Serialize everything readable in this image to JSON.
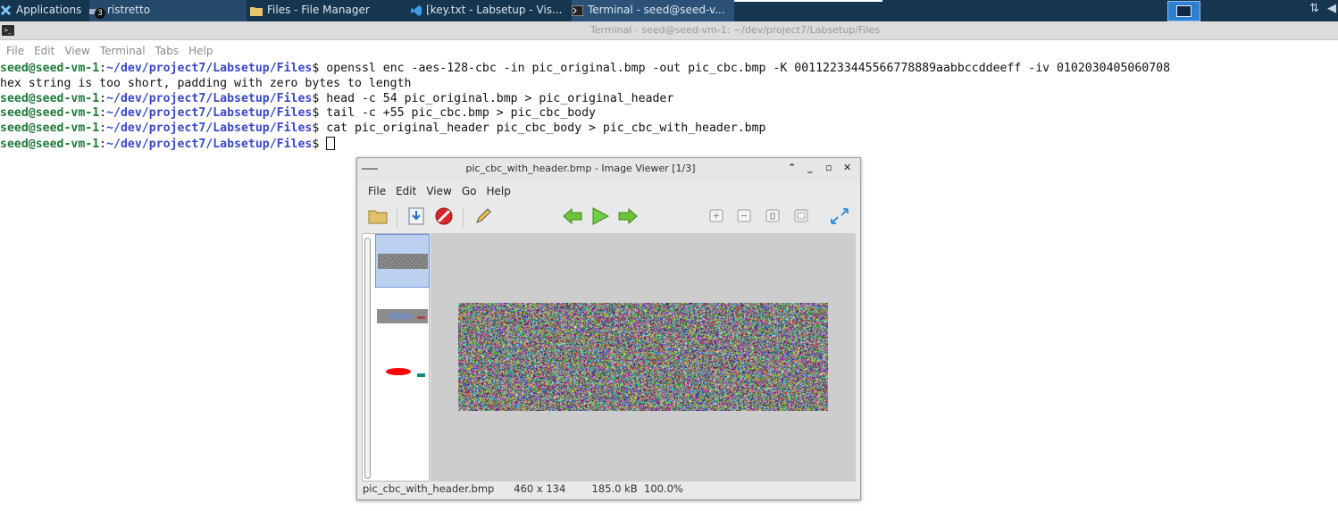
{
  "panel": {
    "applications": "Applications",
    "ristretto_badge": "3",
    "ristretto": "ristretto",
    "file_manager": "Files - File Manager",
    "vscode": "[key.txt - Labsetup - Vis...",
    "terminal": "Terminal - seed@seed-v..."
  },
  "terminal": {
    "title": "Terminal - seed@seed-vm-1: ~/dev/project7/Labsetup/Files",
    "menu": [
      "File",
      "Edit",
      "View",
      "Terminal",
      "Tabs",
      "Help"
    ],
    "prompt_user": "seed@seed-vm-1",
    "prompt_sep": ":",
    "prompt_path": "~/dev/project7/Labsetup/Files",
    "prompt_end": "$ ",
    "lines": [
      {
        "type": "cmd",
        "text": "openssl enc -aes-128-cbc -in pic_original.bmp -out pic_cbc.bmp -K 00112233445566778889aabbccddeeff -iv 0102030405060708"
      },
      {
        "type": "out",
        "text": "hex string is too short, padding with zero bytes to length"
      },
      {
        "type": "cmd",
        "text": "head -c 54 pic_original.bmp > pic_original_header"
      },
      {
        "type": "cmd",
        "text": "tail -c +55 pic_cbc.bmp > pic_cbc_body"
      },
      {
        "type": "cmd",
        "text": "cat pic_original_header pic_cbc_body > pic_cbc_with_header.bmp"
      },
      {
        "type": "cmd",
        "text": ""
      }
    ]
  },
  "viewer": {
    "title": "pic_cbc_with_header.bmp - Image Viewer [1/3]",
    "menu": [
      "File",
      "Edit",
      "View",
      "Go",
      "Help"
    ],
    "status": {
      "filename": "pic_cbc_with_header.bmp",
      "dimensions": "460 x 134",
      "size": "185.0 kB",
      "zoom": "100.0%"
    }
  },
  "colors": {
    "panel": "#16354f",
    "prompt_user": "#1f7a3a",
    "prompt_path": "#3a49c8",
    "thumb_ellipse": "#ff0000",
    "thumb_rect": "#118a8a"
  }
}
